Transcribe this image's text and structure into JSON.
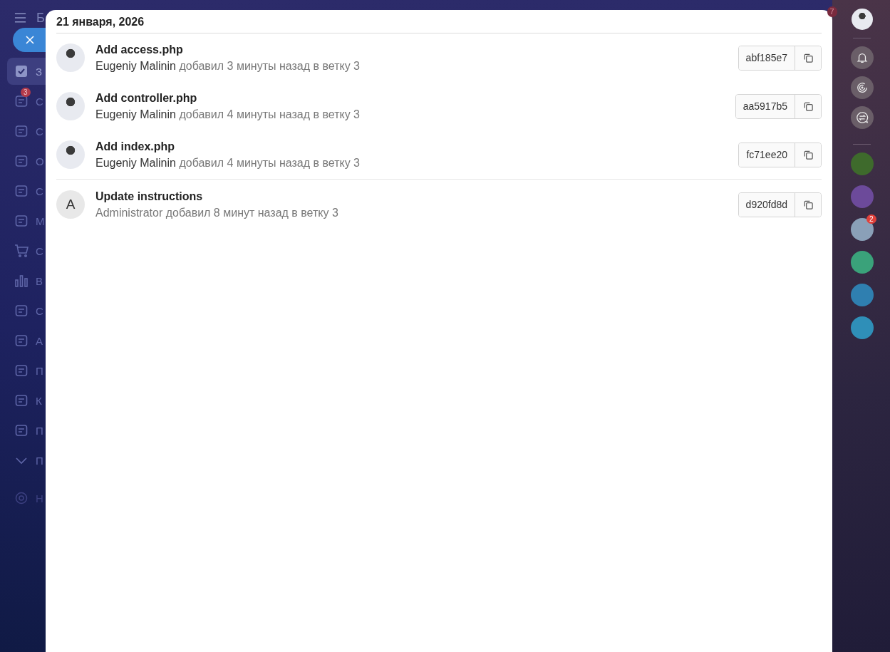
{
  "sidebar": {
    "title_letter": "Б",
    "items": [
      {
        "kind": "checkbox",
        "label": "З",
        "selected": true
      },
      {
        "kind": "generic",
        "label": "С",
        "selected": false,
        "badge": "3"
      },
      {
        "kind": "generic",
        "label": "С",
        "selected": false
      },
      {
        "kind": "generic",
        "label": "О",
        "selected": false
      },
      {
        "kind": "generic",
        "label": "С",
        "selected": false
      },
      {
        "kind": "generic",
        "label": "М",
        "selected": false
      },
      {
        "kind": "cart",
        "label": "С",
        "selected": false
      },
      {
        "kind": "bars",
        "label": "В",
        "selected": false
      },
      {
        "kind": "generic",
        "label": "С",
        "selected": false
      },
      {
        "kind": "generic",
        "label": "А",
        "selected": false
      },
      {
        "kind": "generic",
        "label": "П",
        "selected": false
      },
      {
        "kind": "generic",
        "label": "К",
        "selected": false
      },
      {
        "kind": "generic",
        "label": "П",
        "selected": false
      },
      {
        "kind": "chevron",
        "label": "П",
        "selected": false
      }
    ],
    "settings_label": "Н"
  },
  "panel": {
    "date": "21 января, 2026",
    "commits": [
      {
        "kind": "photo",
        "title": "Add access.php",
        "author": "Eugeniy Malinin",
        "detail": "добавил 3 минуты назад в ветку 3",
        "sha": "abf185e7",
        "group_start": false
      },
      {
        "kind": "photo",
        "title": "Add controller.php",
        "author": "Eugeniy Malinin",
        "detail": "добавил 4 минуты назад в ветку 3",
        "sha": "aa5917b5",
        "group_start": false
      },
      {
        "kind": "photo",
        "title": "Add index.php",
        "author": "Eugeniy Malinin",
        "detail": "добавил 4 минуты назад в ветку 3",
        "sha": "fc71ee20",
        "group_start": false
      },
      {
        "kind": "initial",
        "initial": "A",
        "title": "Update instructions",
        "author": "Administrator",
        "detail": "добавил 8 минут назад в ветку 3",
        "sha": "d920fd8d",
        "group_start": true
      }
    ]
  },
  "rightbar": {
    "badge": "7",
    "tools": [
      {
        "kind": "bell"
      },
      {
        "kind": "swirl"
      },
      {
        "kind": "chat-arrows"
      }
    ],
    "apps": [
      {
        "color": "#3e6a2c"
      },
      {
        "color": "#6c4a9a"
      },
      {
        "color": "#8aa0b8",
        "badge": "2"
      },
      {
        "color": "#3aa27a"
      },
      {
        "color": "#2f7fb0"
      },
      {
        "color": "#2f8fb8"
      }
    ]
  }
}
